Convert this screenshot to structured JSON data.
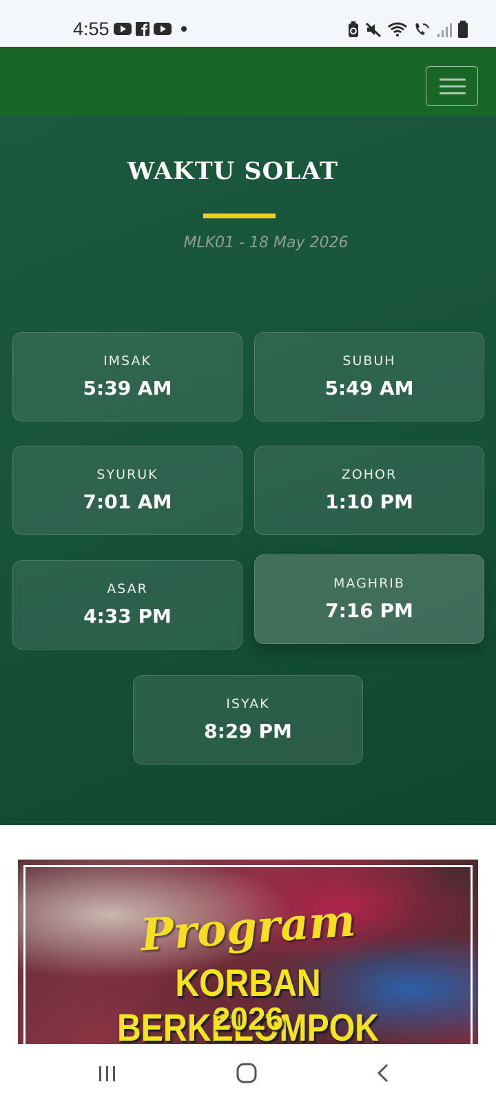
{
  "status_bar": {
    "time": "4:55",
    "left_icons": [
      "youtube-icon",
      "facebook-icon",
      "youtube-icon",
      "dot-icon"
    ],
    "right_icons": [
      "battery-saver-icon",
      "mute-icon",
      "wifi-icon",
      "wifi-call-icon",
      "signal-icon",
      "battery-icon"
    ]
  },
  "navbar": {
    "menu_icon": "hamburger-icon",
    "color": "#1a6626"
  },
  "prayer": {
    "title": "WAKTU SOLAT",
    "subtitle": "MLK01 - 18 May 2026",
    "accent": "#f2d01b",
    "times": [
      {
        "label": "IMSAK",
        "time": "5:39 AM"
      },
      {
        "label": "SUBUH",
        "time": "5:49 AM"
      },
      {
        "label": "SYURUK",
        "time": "7:01 AM"
      },
      {
        "label": "ZOHOR",
        "time": "1:10 PM"
      },
      {
        "label": "ASAR",
        "time": "4:33 PM"
      },
      {
        "label": "MAGHRIB",
        "time": "7:16 PM",
        "active": true
      },
      {
        "label": "ISYAK",
        "time": "8:29 PM"
      }
    ]
  },
  "banner": {
    "program": "Program",
    "headline": "KORBAN BERKELOMPOK",
    "year": "2026"
  },
  "android_nav": {
    "buttons": [
      "recents-icon",
      "home-icon",
      "back-icon"
    ]
  }
}
